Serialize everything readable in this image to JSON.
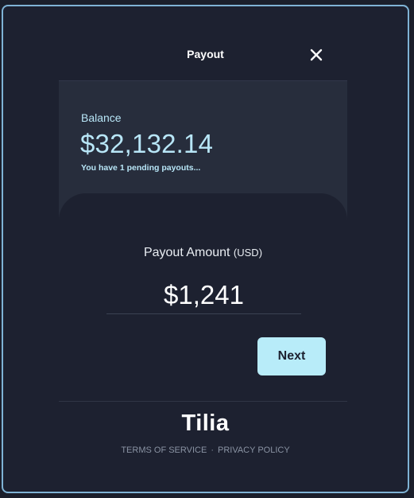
{
  "modal": {
    "title": "Payout",
    "close_icon": "close-icon"
  },
  "balance": {
    "label": "Balance",
    "value": "$32,132.14",
    "pending_text": "You have 1 pending payouts..."
  },
  "payout": {
    "label": "Payout Amount",
    "unit": "(USD)",
    "amount": "$1,241",
    "next_label": "Next"
  },
  "footer": {
    "logo": "Tilia",
    "terms": "TERMS OF SERVICE",
    "separator": "·",
    "privacy": "PRIVACY POLICY"
  },
  "colors": {
    "accent": "#b8ecf9",
    "border": "#7fb3d5",
    "background": "#1d2130",
    "card": "#272d3c"
  }
}
